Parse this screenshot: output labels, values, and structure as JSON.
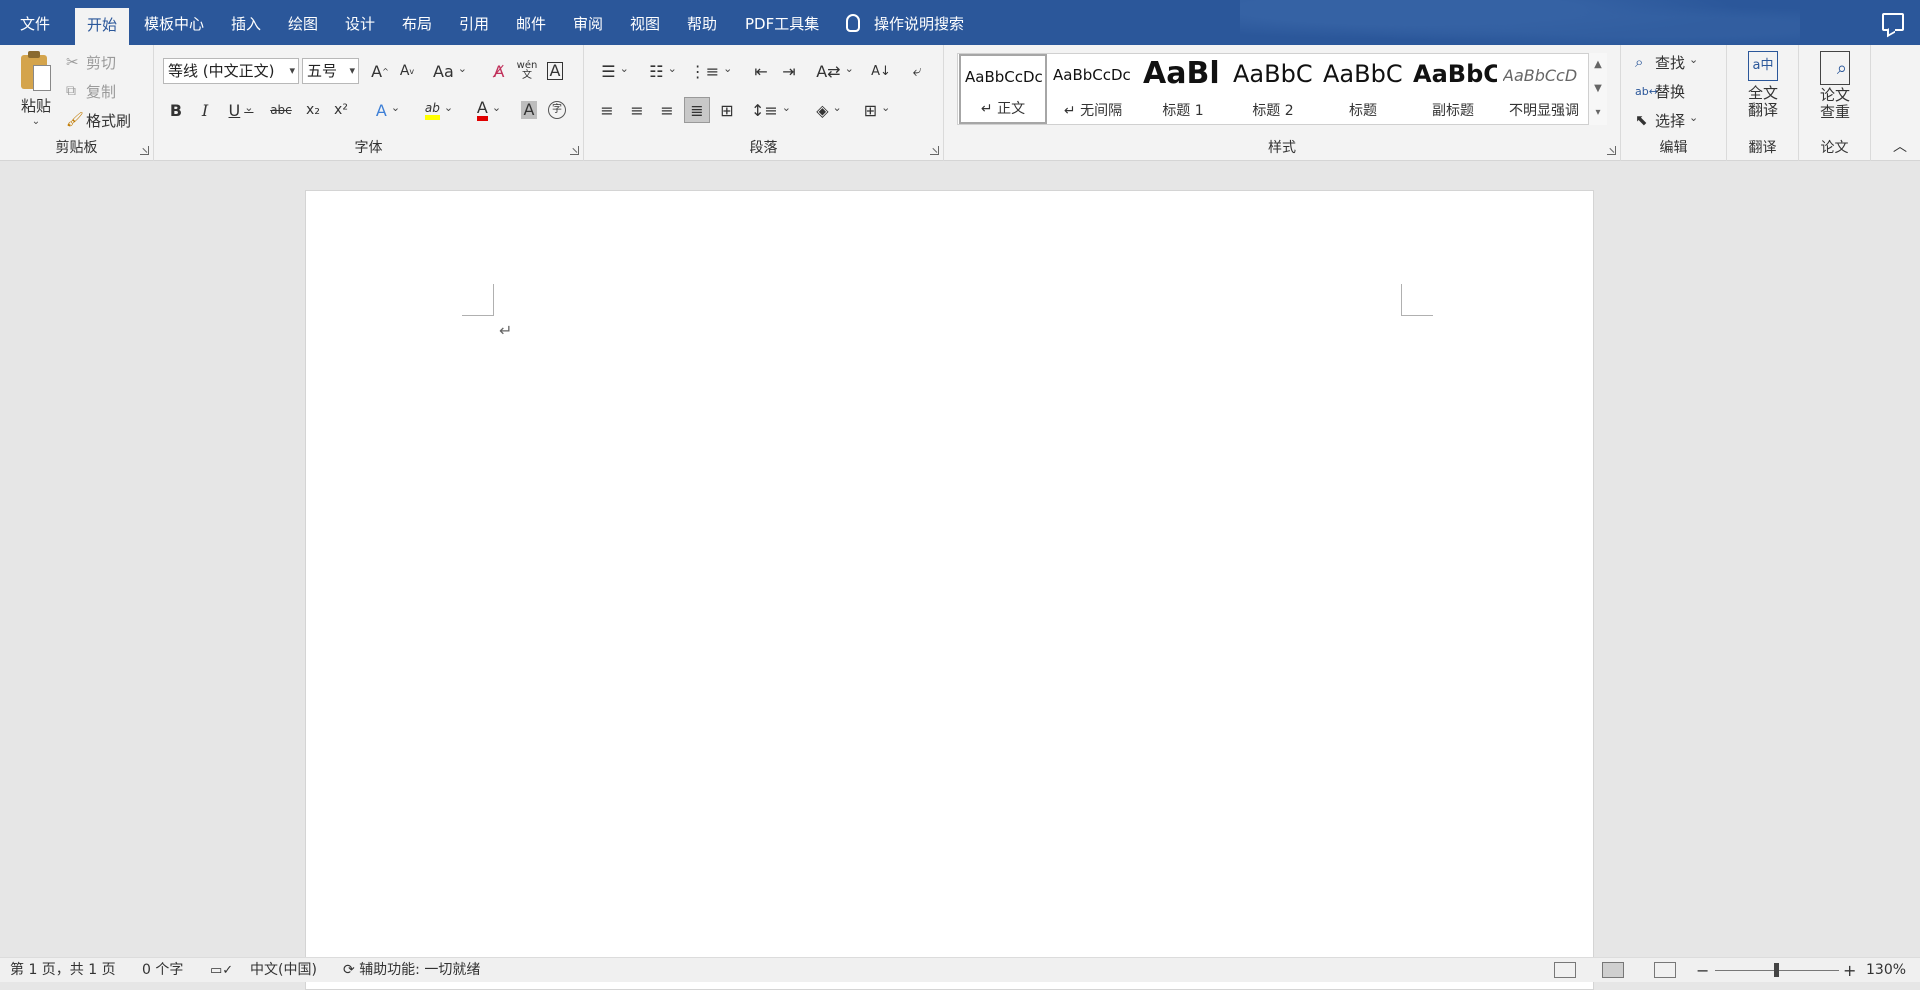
{
  "tabs": [
    "文件",
    "开始",
    "模板中心",
    "插入",
    "绘图",
    "设计",
    "布局",
    "引用",
    "邮件",
    "审阅",
    "视图",
    "帮助",
    "PDF工具集"
  ],
  "active_tab": "开始",
  "tell_me": "操作说明搜索",
  "clipboard": {
    "paste": "粘贴",
    "cut": "剪切",
    "copy": "复制",
    "format_painter": "格式刷",
    "label": "剪贴板"
  },
  "font": {
    "name": "等线 (中文正文)",
    "size": "五号",
    "label": "字体",
    "grow": "A",
    "shrink": "A",
    "change_case": "Aa",
    "bold": "B",
    "italic": "I",
    "underline": "U",
    "strike": "abc",
    "subscript": "x₂",
    "superscript": "x²",
    "phonetic": "wén\n文",
    "char_border": "A",
    "font_color_letter": "A",
    "char_shading": "A",
    "enclose": "字"
  },
  "paragraph": {
    "label": "段落"
  },
  "styles": {
    "label": "样式",
    "items": [
      {
        "sample": "AaBbCcDc",
        "name": "↵ 正文"
      },
      {
        "sample": "AaBbCcDc",
        "name": "↵ 无间隔"
      },
      {
        "sample": "AaBl",
        "name": "标题 1"
      },
      {
        "sample": "AaBbC",
        "name": "标题 2"
      },
      {
        "sample": "AaBbC",
        "name": "标题"
      },
      {
        "sample": "AaBbC",
        "name": "副标题"
      },
      {
        "sample": "AaBbCcD",
        "name": "不明显强调"
      }
    ]
  },
  "editing": {
    "find": "查找",
    "replace": "替换",
    "select": "选择",
    "label": "编辑"
  },
  "translate": {
    "full": "全文\n翻译",
    "label": "翻译"
  },
  "thesis": {
    "check": "论文\n查重",
    "label": "论文"
  },
  "document": {
    "paragraph_mark": "↵"
  },
  "status": {
    "page": "第 1 页，共 1 页",
    "words": "0 个字",
    "language": "中文(中国)",
    "accessibility": "辅助功能: 一切就绪",
    "zoom": "130%"
  },
  "colors": {
    "tab_bar": "#2b579a",
    "ribbon": "#f3f3f3",
    "canvas": "#e6e6e6",
    "highlight_yellow": "#ffff00",
    "font_red": "#e00000"
  }
}
